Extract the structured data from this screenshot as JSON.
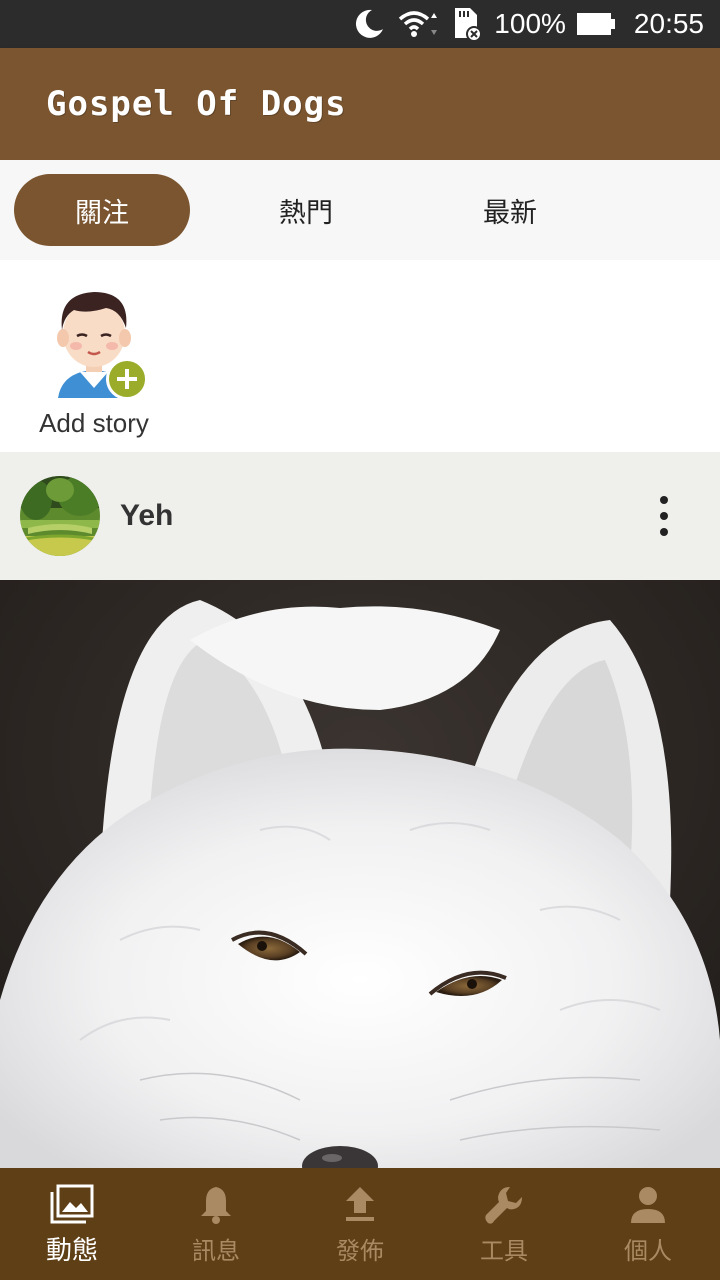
{
  "status_bar": {
    "battery_percent": "100%",
    "time": "20:55",
    "icons": [
      "moon-icon",
      "wifi-icon",
      "sd-card-icon",
      "battery-icon"
    ]
  },
  "app_bar": {
    "title": "Gospel Of Dogs"
  },
  "tabs": [
    {
      "label": "關注",
      "active": true
    },
    {
      "label": "熱門",
      "active": false
    },
    {
      "label": "最新",
      "active": false
    }
  ],
  "stories": {
    "items": [
      {
        "label": "Add story",
        "icon": "add-icon"
      }
    ]
  },
  "post": {
    "username": "Yeh",
    "more_icon": "more-vertical-icon"
  },
  "bottom_nav": {
    "items": [
      {
        "label": "動態",
        "icon": "photo-library-icon",
        "active": true
      },
      {
        "label": "訊息",
        "icon": "bell-icon",
        "active": false
      },
      {
        "label": "發佈",
        "icon": "upload-icon",
        "active": false
      },
      {
        "label": "工具",
        "icon": "wrench-icon",
        "active": false
      },
      {
        "label": "個人",
        "icon": "person-icon",
        "active": false
      }
    ]
  },
  "colors": {
    "brand": "#7a5530",
    "bottom_nav": "#5f3f16",
    "story_add": "#9aac2a",
    "status_bar": "#2c2c2c"
  }
}
